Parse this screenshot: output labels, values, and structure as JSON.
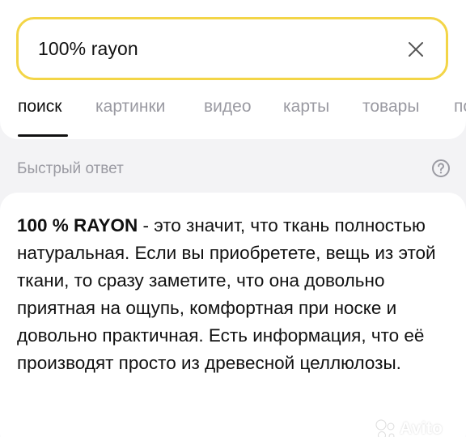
{
  "search": {
    "query": "100% rayon",
    "clear_icon": "close-icon"
  },
  "tabs": [
    {
      "label": "поиск",
      "active": true
    },
    {
      "label": "картинки",
      "active": false
    },
    {
      "label": "видео",
      "active": false
    },
    {
      "label": "карты",
      "active": false
    },
    {
      "label": "товары",
      "active": false
    },
    {
      "label": "по",
      "active": false
    }
  ],
  "quick_answer": {
    "title": "Быстрый ответ",
    "help_icon": "question-circle-icon",
    "term": "100 % RAYON",
    "text": " - это значит, что ткань полностью натуральная. Если вы приобретете, вещь из этой ткани, то сразу заметите, что она довольно приятная на ощупь, комфортная при носке и довольно практичная. Есть информация, что её производят просто из древесной целлюлозы."
  },
  "watermark": {
    "text": "Avito",
    "logo_icon": "avito-logo-icon"
  },
  "colors": {
    "search_border": "#f3d547",
    "background": "#f3f3f5",
    "muted_text": "#9a9aa2"
  }
}
